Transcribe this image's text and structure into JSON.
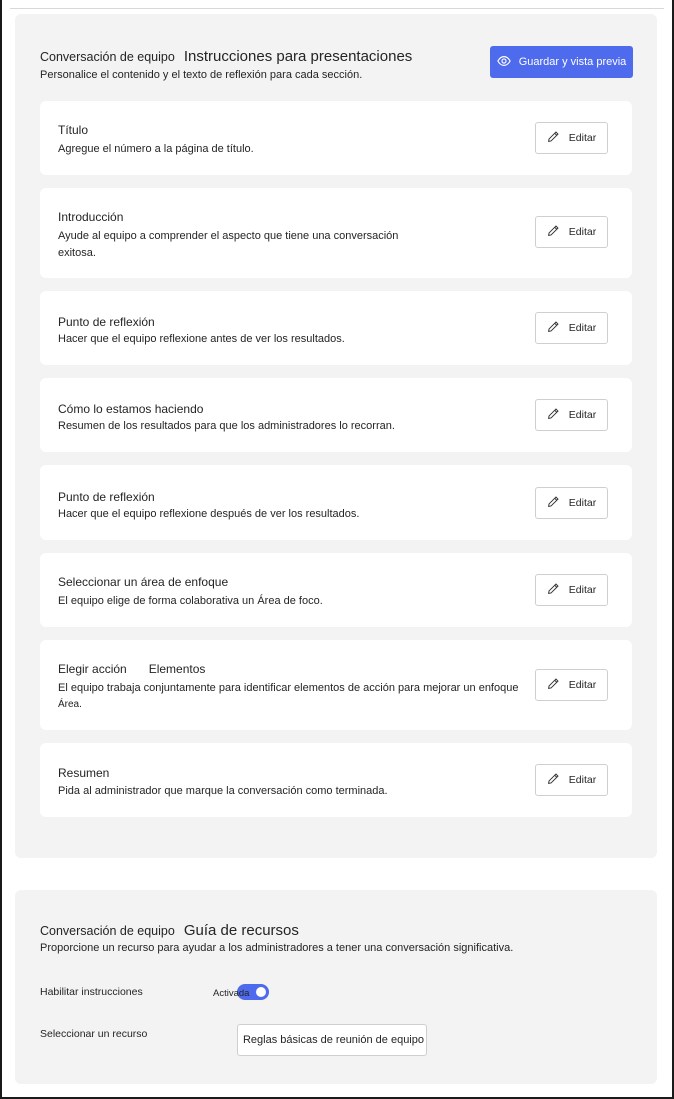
{
  "presentation": {
    "subtitle": "Conversación de equipo",
    "title": "Instrucciones para presentaciones",
    "description": "Personalice el contenido y el texto de reflexión para cada sección.",
    "preview_button": "Guardar y vista previa",
    "accent_color": "#4f6bed",
    "cards": [
      {
        "title": "Título",
        "title_extra": "",
        "desc": "Agregue el número a la página de título.",
        "desc2": "",
        "edit": "Editar"
      },
      {
        "title": "Introducción",
        "title_extra": "",
        "desc": "Ayude al equipo a comprender el aspecto que tiene una conversación",
        "desc2": "exitosa.",
        "edit": "Editar"
      },
      {
        "title": "Punto de reflexión",
        "title_extra": "",
        "desc": "Hacer que el equipo reflexione antes de ver los resultados.",
        "desc2": "",
        "edit": "Editar"
      },
      {
        "title": "Cómo lo estamos haciendo",
        "title_extra": "",
        "desc": "Resumen de los resultados para que los administradores lo recorran.",
        "desc2": "",
        "edit": "Editar"
      },
      {
        "title": "Punto de reflexión",
        "title_extra": "",
        "desc": "Hacer que el equipo reflexione después de ver los resultados.",
        "desc2": "",
        "edit": "Editar"
      },
      {
        "title": "Seleccionar un área de enfoque",
        "title_extra": "",
        "desc": "El equipo elige de forma colaborativa un Área de foco.",
        "desc2": "",
        "edit": "Editar"
      },
      {
        "title": "Elegir acción",
        "title_extra": "Elementos",
        "desc": "El equipo trabaja conjuntamente para identificar elementos de acción para mejorar un enfoque",
        "desc2": "Área.",
        "edit": "Editar"
      },
      {
        "title": "Resumen",
        "title_extra": "",
        "desc": "Pida al administrador que marque la conversación como terminada.",
        "desc2": "",
        "edit": "Editar"
      }
    ]
  },
  "resources": {
    "subtitle": "Conversación de equipo",
    "title": "Guía de recursos",
    "description": "Proporcione un recurso para ayudar a los administradores a tener una conversación significativa.",
    "enable_label": "Habilitar instrucciones",
    "toggle_state": "Activada",
    "toggle_on": true,
    "select_label": "Seleccionar un recurso",
    "select_value": "Reglas básicas de reunión de equipo"
  }
}
